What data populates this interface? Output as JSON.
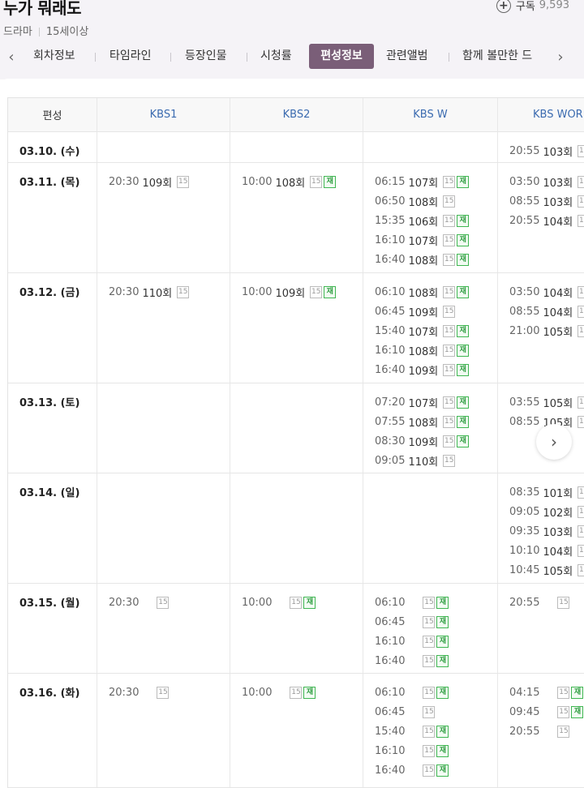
{
  "program": {
    "title": "누가 뭐래도",
    "genre": "드라마",
    "rating": "15세이상",
    "subscribe_label": "구독",
    "subscriber_count": "9,593"
  },
  "tabs": [
    {
      "label": "회차정보",
      "active": false
    },
    {
      "label": "타임라인",
      "active": false
    },
    {
      "label": "등장인물",
      "active": false
    },
    {
      "label": "시청률",
      "active": false
    },
    {
      "label": "편성정보",
      "active": true
    },
    {
      "label": "관련앨범",
      "active": false
    },
    {
      "label": "함께 볼만한 드",
      "active": false
    }
  ],
  "icons": {
    "left_arrow": "chevron-left-icon",
    "right_arrow": "chevron-right-icon",
    "subscribe": "plus-circle-icon",
    "next": "chevron-right-icon"
  },
  "colors": {
    "active_tab": "#7a5e78",
    "channel_header": "#3b6bb0",
    "rerun_badge": "#3fb651"
  },
  "schedule": {
    "header": [
      "편성",
      "KBS1",
      "KBS2",
      "KBS W",
      "KBS WOR"
    ],
    "badges": {
      "age": "15",
      "rerun": "재"
    },
    "rows": [
      {
        "date": "03.10. (수)",
        "cells": [
          [],
          [],
          [],
          [
            {
              "time": "20:55",
              "ep": "103회",
              "rerun": false
            }
          ]
        ]
      },
      {
        "date": "03.11. (목)",
        "cells": [
          [
            {
              "time": "20:30",
              "ep": "109회",
              "rerun": false
            }
          ],
          [
            {
              "time": "10:00",
              "ep": "108회",
              "rerun": true
            }
          ],
          [
            {
              "time": "06:15",
              "ep": "107회",
              "rerun": true
            },
            {
              "time": "06:50",
              "ep": "108회",
              "rerun": false
            },
            {
              "time": "15:35",
              "ep": "106회",
              "rerun": true
            },
            {
              "time": "16:10",
              "ep": "107회",
              "rerun": true
            },
            {
              "time": "16:40",
              "ep": "108회",
              "rerun": true
            }
          ],
          [
            {
              "time": "03:50",
              "ep": "103회",
              "rerun": false
            },
            {
              "time": "08:55",
              "ep": "103회",
              "rerun": false
            },
            {
              "time": "20:55",
              "ep": "104회",
              "rerun": false
            }
          ]
        ]
      },
      {
        "date": "03.12. (금)",
        "cells": [
          [
            {
              "time": "20:30",
              "ep": "110회",
              "rerun": false
            }
          ],
          [
            {
              "time": "10:00",
              "ep": "109회",
              "rerun": true
            }
          ],
          [
            {
              "time": "06:10",
              "ep": "108회",
              "rerun": true
            },
            {
              "time": "06:45",
              "ep": "109회",
              "rerun": false
            },
            {
              "time": "15:40",
              "ep": "107회",
              "rerun": true
            },
            {
              "time": "16:10",
              "ep": "108회",
              "rerun": true
            },
            {
              "time": "16:40",
              "ep": "109회",
              "rerun": true
            }
          ],
          [
            {
              "time": "03:50",
              "ep": "104회",
              "rerun": false
            },
            {
              "time": "08:55",
              "ep": "104회",
              "rerun": false
            },
            {
              "time": "21:00",
              "ep": "105회",
              "rerun": false
            }
          ]
        ]
      },
      {
        "date": "03.13. (토)",
        "cells": [
          [],
          [],
          [
            {
              "time": "07:20",
              "ep": "107회",
              "rerun": true
            },
            {
              "time": "07:55",
              "ep": "108회",
              "rerun": true
            },
            {
              "time": "08:30",
              "ep": "109회",
              "rerun": true
            },
            {
              "time": "09:05",
              "ep": "110회",
              "rerun": false
            }
          ],
          [
            {
              "time": "03:55",
              "ep": "105회",
              "rerun": false
            },
            {
              "time": "08:55",
              "ep": "105회",
              "rerun": false
            }
          ]
        ]
      },
      {
        "date": "03.14. (일)",
        "cells": [
          [],
          [],
          [],
          [
            {
              "time": "08:35",
              "ep": "101회",
              "rerun": false
            },
            {
              "time": "09:05",
              "ep": "102회",
              "rerun": false
            },
            {
              "time": "09:35",
              "ep": "103회",
              "rerun": false
            },
            {
              "time": "10:10",
              "ep": "104회",
              "rerun": false
            },
            {
              "time": "10:45",
              "ep": "105회",
              "rerun": false
            }
          ]
        ]
      },
      {
        "date": "03.15. (월)",
        "cells": [
          [
            {
              "time": "20:30",
              "ep": "",
              "rerun": false
            }
          ],
          [
            {
              "time": "10:00",
              "ep": "",
              "rerun": true
            }
          ],
          [
            {
              "time": "06:10",
              "ep": "",
              "rerun": true
            },
            {
              "time": "06:45",
              "ep": "",
              "rerun": true
            },
            {
              "time": "16:10",
              "ep": "",
              "rerun": true
            },
            {
              "time": "16:40",
              "ep": "",
              "rerun": true
            }
          ],
          [
            {
              "time": "20:55",
              "ep": "",
              "rerun": false
            }
          ]
        ]
      },
      {
        "date": "03.16. (화)",
        "cells": [
          [
            {
              "time": "20:30",
              "ep": "",
              "rerun": false
            }
          ],
          [
            {
              "time": "10:00",
              "ep": "",
              "rerun": true
            }
          ],
          [
            {
              "time": "06:10",
              "ep": "",
              "rerun": true
            },
            {
              "time": "06:45",
              "ep": "",
              "rerun": false
            },
            {
              "time": "15:40",
              "ep": "",
              "rerun": true
            },
            {
              "time": "16:10",
              "ep": "",
              "rerun": true
            },
            {
              "time": "16:40",
              "ep": "",
              "rerun": true
            }
          ],
          [
            {
              "time": "04:15",
              "ep": "",
              "rerun": true
            },
            {
              "time": "09:45",
              "ep": "",
              "rerun": true
            },
            {
              "time": "20:55",
              "ep": "",
              "rerun": false
            }
          ]
        ]
      }
    ]
  }
}
